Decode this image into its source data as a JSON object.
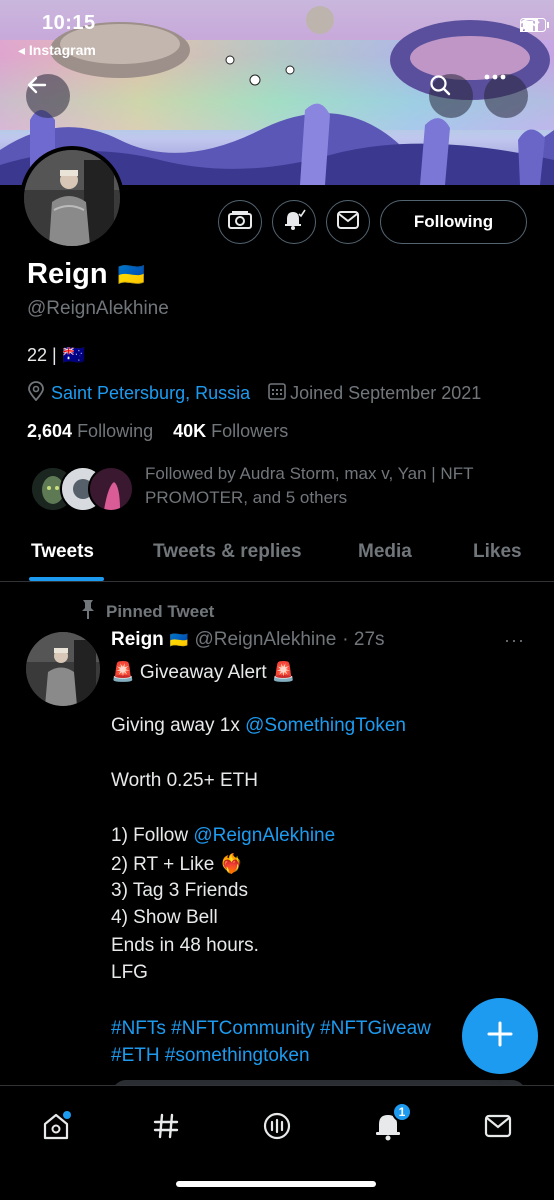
{
  "status_bar": {
    "time": "10:15",
    "back_app": "◂ Instagram"
  },
  "profile": {
    "name": "Reign",
    "name_flag": "🇺🇦",
    "handle": "@ReignAlekhine",
    "bio_age": "22 |",
    "bio_flag": "🇦🇺",
    "location": "Saint Petersburg, Russia",
    "joined": "Joined September 2021",
    "following_count": "2,604",
    "following_label": "Following",
    "followers_count": "40K",
    "followers_label": "Followers",
    "followed_by": "Followed by Audra Storm, max v, Yan | NFT PROMOTER, and 5 others",
    "follow_button": "Following"
  },
  "tabs": [
    {
      "label": "Tweets",
      "active": true
    },
    {
      "label": "Tweets & replies",
      "active": false
    },
    {
      "label": "Media",
      "active": false
    },
    {
      "label": "Likes",
      "active": false
    }
  ],
  "tweet": {
    "pinned_label": "Pinned Tweet",
    "author": "Reign",
    "author_flag": "🇺🇦",
    "handle": "@ReignAlekhine",
    "time": "· 27s",
    "more": "···",
    "lines": {
      "alert": "🚨 Giveaway Alert 🚨",
      "give_pre": "Giving away 1x ",
      "give_link": "@SomethingToken",
      "worth": "Worth 0.25+ ETH",
      "step1_pre": "1) Follow ",
      "step1_link": "@ReignAlekhine",
      "step2": "2) RT + Like ❤️‍🔥",
      "step3": "3) Tag 3 Friends",
      "step4": "4) Show Bell",
      "ends": "Ends in 48 hours.",
      "lfg": "LFG",
      "hashtags1": "#NFTs #NFTCommunity #NFTGiveaw",
      "hashtags2": "#ETH #somethingtoken"
    }
  },
  "bottom_nav": {
    "notification_badge": "1"
  },
  "colors": {
    "accent": "#1d9bf0",
    "background": "#000000",
    "muted": "#71767b"
  },
  "icons": [
    "back-arrow-icon",
    "search-icon",
    "more-icon",
    "tip-jar-icon",
    "notification-bell-icon",
    "message-icon",
    "location-icon",
    "calendar-icon",
    "pin-icon",
    "compose-plus-icon",
    "home-icon",
    "explore-hashtag-icon",
    "spaces-icon",
    "notifications-icon",
    "messages-icon"
  ]
}
